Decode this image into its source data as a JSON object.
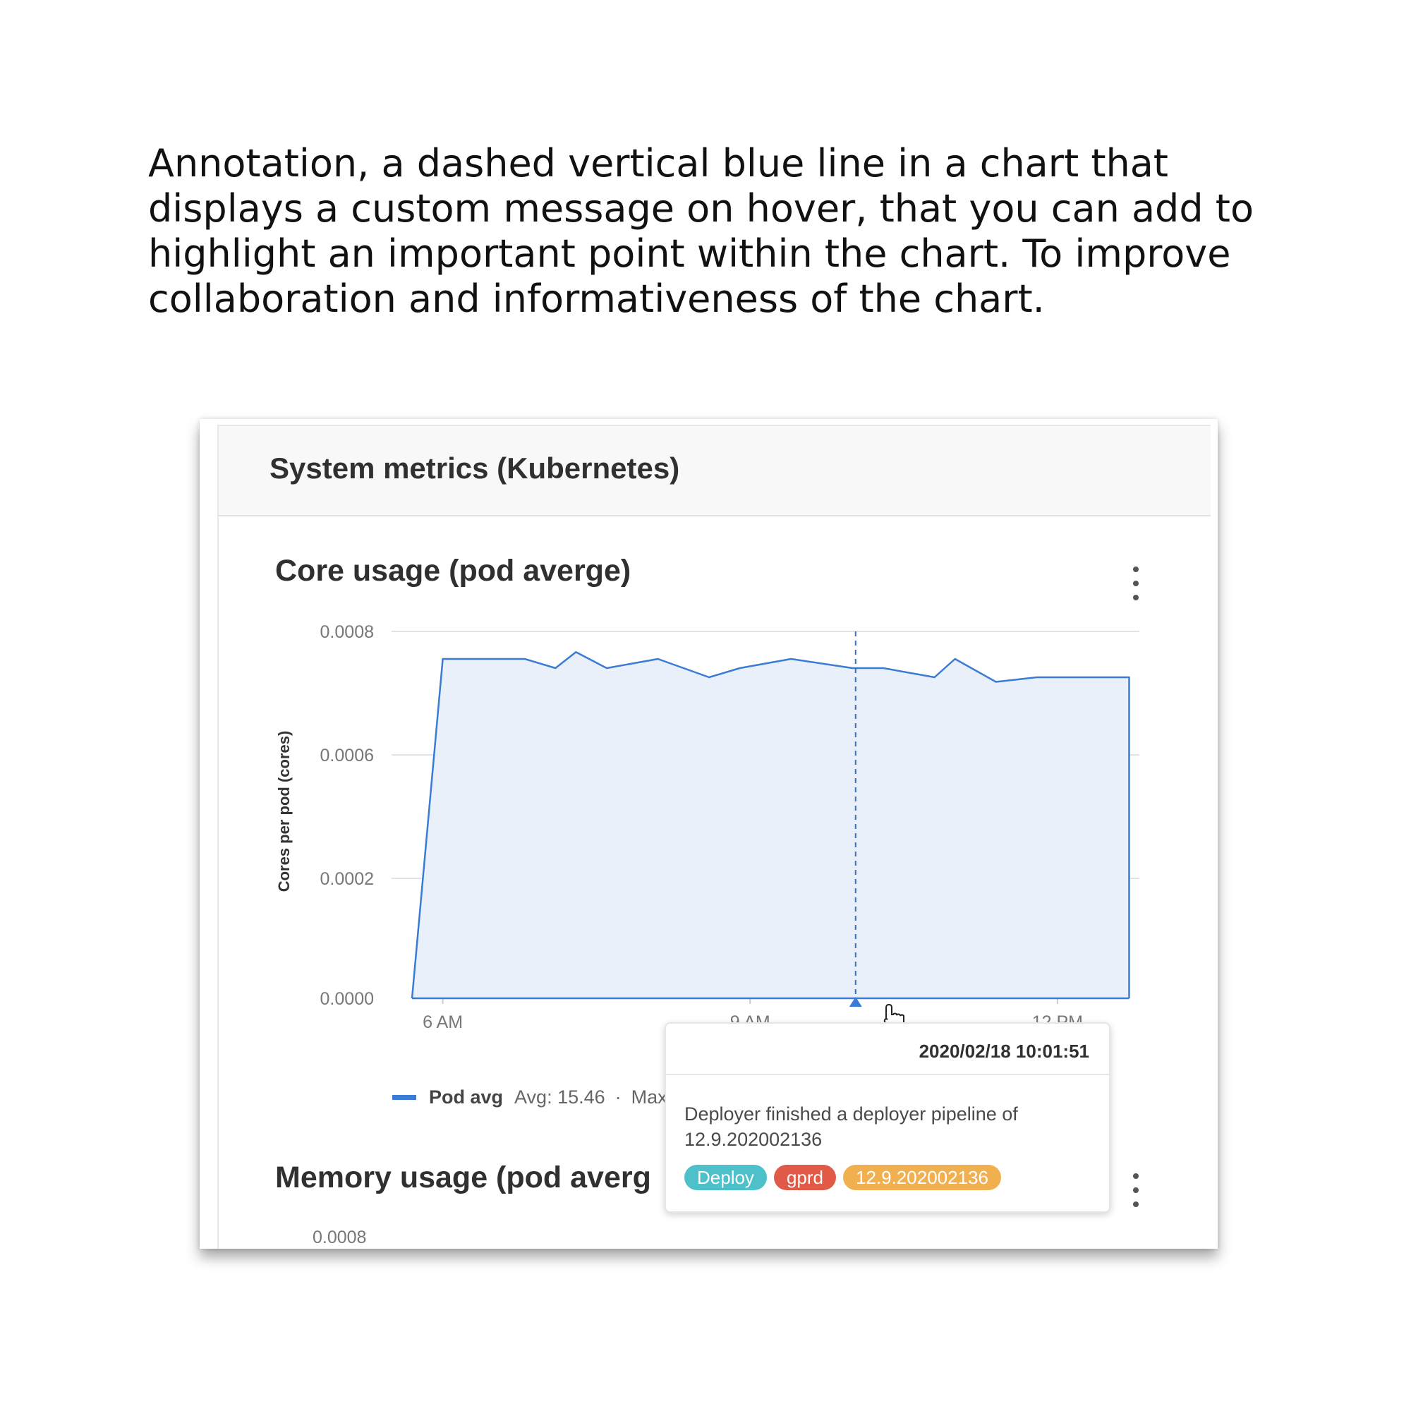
{
  "caption": "Annotation, a dashed vertical blue line in a chart that displays a custom message on hover, that you can add to highlight an important point within the chart. To improve collaboration and informativeness of the chart.",
  "dashboard": {
    "title": "System metrics (Kubernetes)",
    "panels": [
      {
        "title": "Core usage (pod averge)"
      },
      {
        "title": "Memory usage (pod averg"
      }
    ]
  },
  "legend": {
    "name": "Pod avg",
    "avg": "Avg: 15.46",
    "sep": "·",
    "max": "Max"
  },
  "next_chart_tick": "0.0008",
  "tooltip": {
    "timestamp": "2020/02/18 10:01:51",
    "message": "Deployer finished a deployer pipeline of 12.9.202002136",
    "badges": [
      {
        "label": "Deploy",
        "color": "#4dc0c9"
      },
      {
        "label": "gprd",
        "color": "#e05a47"
      },
      {
        "label": "12.9.202002136",
        "color": "#f0b050"
      }
    ]
  },
  "colors": {
    "series": "#3a7bd5",
    "fill": "#eaf0f9",
    "annotation": "#3a6fb5"
  },
  "chart_data": {
    "type": "area",
    "title": "Core usage (pod averge)",
    "xlabel": "",
    "ylabel": "Cores per pod (cores)",
    "x_ticks": [
      {
        "label": "6 AM",
        "hour": 6.0
      },
      {
        "label": "9 AM",
        "hour": 9.0
      },
      {
        "label": "12 PM",
        "hour": 12.0
      }
    ],
    "y_ticks": [
      "0.0008",
      "0.0006",
      "0.0002",
      "0.0000"
    ],
    "y_tick_values": [
      0.0008,
      0.0006,
      0.0002,
      0.0
    ],
    "xlim": [
      5.5,
      12.8
    ],
    "series": [
      {
        "name": "Pod avg",
        "x": [
          5.7,
          6.0,
          6.4,
          6.8,
          7.1,
          7.3,
          7.6,
          8.1,
          8.6,
          8.9,
          9.4,
          10.0,
          10.3,
          10.8,
          11.0,
          11.4,
          11.8,
          12.2,
          12.7
        ],
        "y": [
          0.0,
          0.00074,
          0.00074,
          0.00074,
          0.00072,
          0.000755,
          0.00072,
          0.00074,
          0.0007,
          0.00072,
          0.00074,
          0.00072,
          0.00072,
          0.0007,
          0.00074,
          0.00069,
          0.0007,
          0.0007,
          0.0007
        ]
      }
    ],
    "annotations": [
      {
        "x": 10.03,
        "label": "2020/02/18 10:01:51"
      }
    ],
    "grid": true
  }
}
